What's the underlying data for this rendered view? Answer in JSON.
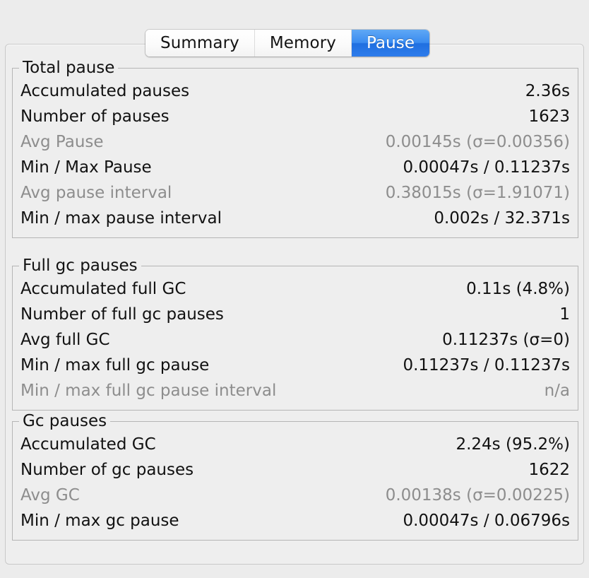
{
  "tabs": [
    {
      "label": "Summary",
      "selected": false
    },
    {
      "label": "Memory",
      "selected": false
    },
    {
      "label": "Pause",
      "selected": true
    }
  ],
  "colors": {
    "selected_tab": "#2e7ceb",
    "window_background": "#ececec",
    "panel_background": "#eeeeee",
    "text": "#111111",
    "dim_text": "#8d8d8d",
    "group_border": "#b5b5b5"
  },
  "groups": [
    {
      "title": "Total pause",
      "rows": [
        {
          "label": "Accumulated pauses",
          "value": "2.36s",
          "dim": false
        },
        {
          "label": "Number of pauses",
          "value": "1623",
          "dim": false
        },
        {
          "label": "Avg Pause",
          "value": "0.00145s (σ=0.00356)",
          "dim": true
        },
        {
          "label": "Min / Max Pause",
          "value": "0.00047s / 0.11237s",
          "dim": false
        },
        {
          "label": "Avg pause interval",
          "value": "0.38015s (σ=1.91071)",
          "dim": true
        },
        {
          "label": "Min / max pause interval",
          "value": "0.002s / 32.371s",
          "dim": false
        }
      ]
    },
    {
      "title": "Full gc pauses",
      "rows": [
        {
          "label": "Accumulated full GC",
          "value": "0.11s (4.8%)",
          "dim": false
        },
        {
          "label": "Number of full gc pauses",
          "value": "1",
          "dim": false
        },
        {
          "label": "Avg full GC",
          "value": "0.11237s (σ=0)",
          "dim": false
        },
        {
          "label": "Min / max full gc pause",
          "value": "0.11237s / 0.11237s",
          "dim": false
        },
        {
          "label": "Min / max full gc pause interval",
          "value": "n/a",
          "dim": true
        }
      ]
    },
    {
      "title": "Gc pauses",
      "rows": [
        {
          "label": "Accumulated GC",
          "value": "2.24s (95.2%)",
          "dim": false
        },
        {
          "label": "Number of gc pauses",
          "value": "1622",
          "dim": false
        },
        {
          "label": "Avg GC",
          "value": "0.00138s (σ=0.00225)",
          "dim": true
        },
        {
          "label": "Min / max gc pause",
          "value": "0.00047s / 0.06796s",
          "dim": false
        }
      ]
    }
  ]
}
